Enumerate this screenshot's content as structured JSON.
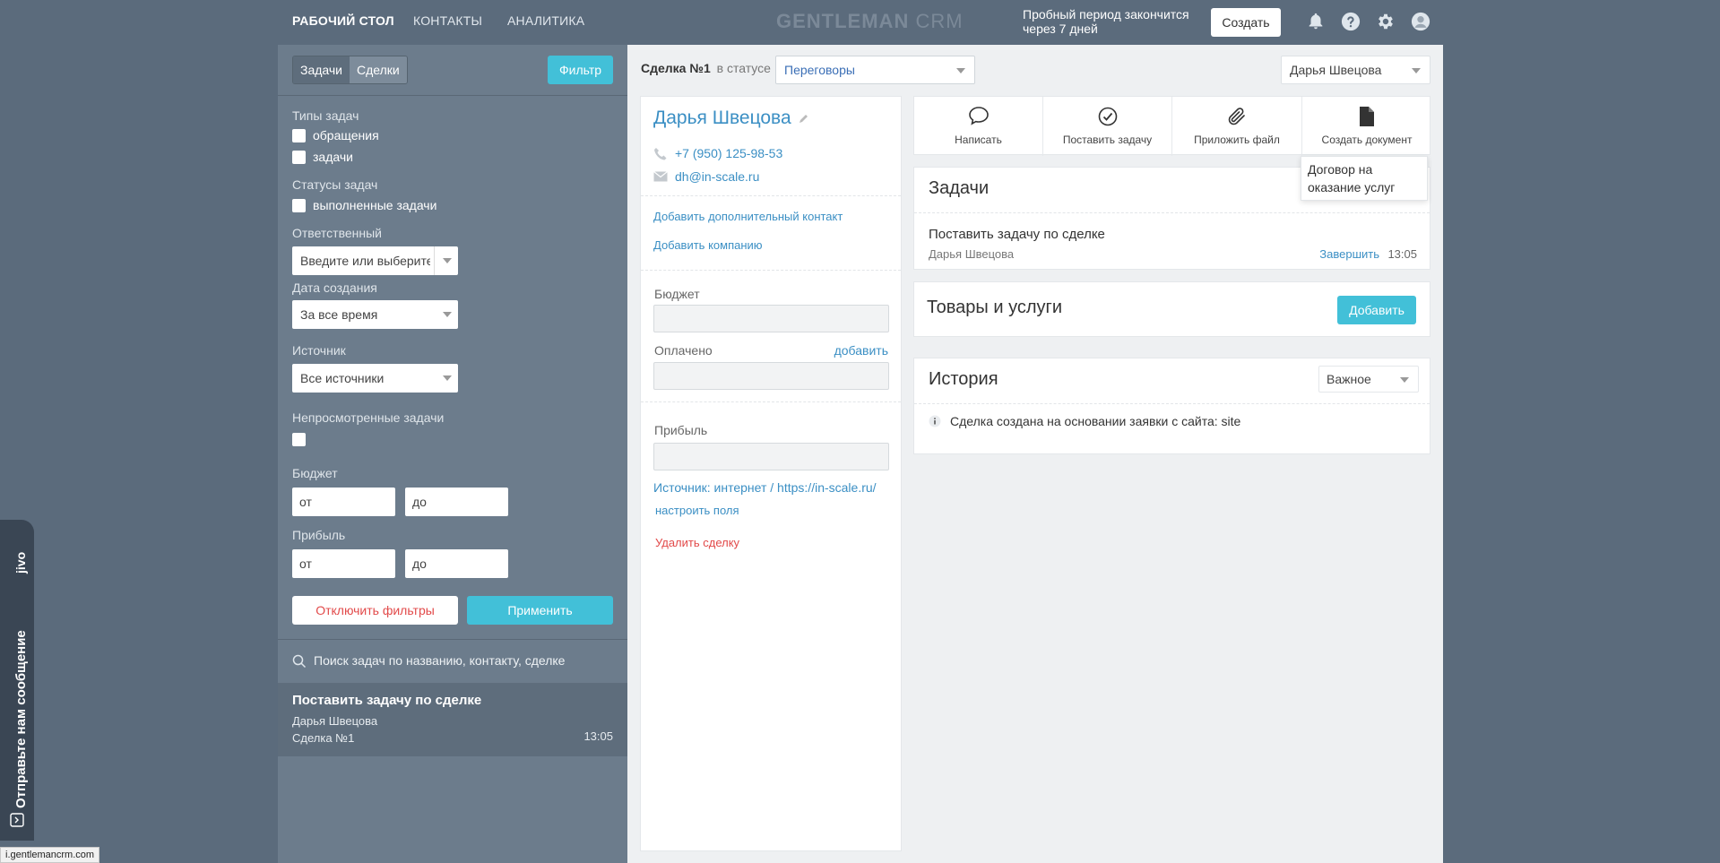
{
  "topbar": {
    "nav": [
      "РАБОЧИЙ СТОЛ",
      "КОНТАКТЫ",
      "АНАЛИТИКА"
    ],
    "logo_main": "GENTLEMAN",
    "logo_suffix": "CRM",
    "trial_text": "Пробный период закончится через 7 дней",
    "create_label": "Создать",
    "icons": [
      "bell-icon",
      "help-icon",
      "gear-icon",
      "user-icon"
    ]
  },
  "left": {
    "tabs": [
      "Задачи",
      "Сделки"
    ],
    "filter_label": "Фильтр",
    "task_types_label": "Типы задач",
    "task_types": [
      "обращения",
      "задачи"
    ],
    "task_status_label": "Статусы задач",
    "task_status": [
      "выполненные задачи"
    ],
    "responsible_label": "Ответственный",
    "responsible_placeholder": "Введите или выберите",
    "created_label": "Дата создания",
    "created_value": "За все время",
    "source_label": "Источник",
    "source_value": "Все источники",
    "unseen_label": "Непросмотренные задачи",
    "budget_label": "Бюджет",
    "profit_label": "Прибыль",
    "from": "от",
    "to": "до",
    "disable_filters": "Отключить фильтры",
    "apply": "Применить",
    "search_placeholder": "Поиск задач по названию, контакту, сделке",
    "task_item": {
      "title": "Поставить задачу по сделке",
      "person": "Дарья Швецова",
      "deal": "Сделка №1",
      "time": "13:05"
    }
  },
  "deal": {
    "title": "Сделка №1",
    "status_prefix": "в статусе",
    "status": "Переговоры",
    "assignee": "Дарья Швецова",
    "contact": {
      "name": "Дарья Швецова",
      "phone": "+7 (950) 125-98-53",
      "email": "dh@in-scale.ru",
      "add_contact": "Добавить дополнительный контакт",
      "add_company": "Добавить компанию",
      "budget_label": "Бюджет",
      "paid_label": "Оплачено",
      "paid_add": "добавить",
      "profit_label": "Прибыль",
      "source": "Источник: интернет / https://in-scale.ru/",
      "configure": "настроить поля",
      "delete": "Удалить сделку"
    },
    "actions": [
      "Написать",
      "Поставить задачу",
      "Приложить файл",
      "Создать документ"
    ],
    "tooltip": "Договор на оказание услуг",
    "tasks_title": "Задачи",
    "task": {
      "title": "Поставить задачу по сделке",
      "person": "Дарья Швецова",
      "complete": "Завершить",
      "time": "13:05"
    },
    "goods_title": "Товары и услуги",
    "goods_add": "Добавить",
    "history_title": "История",
    "history_filter": "Важное",
    "history_item": "Сделка создана на основании заявки с сайта: site"
  },
  "jivo": {
    "brand": "jivo",
    "message": "Отправьте нам сообщение"
  },
  "statusbar": "i.gentlemancrm.com",
  "colors": {
    "accent": "#42c0d8",
    "link": "#3b8fc4",
    "danger": "#e24a4a",
    "sidebar": "#6c7c8c"
  }
}
